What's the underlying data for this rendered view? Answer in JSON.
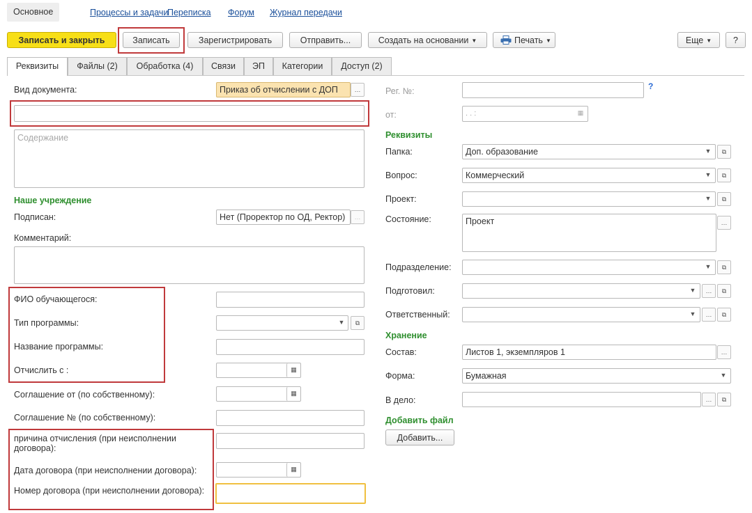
{
  "nav": {
    "active": "Основное",
    "items": [
      "Процессы и задачи",
      "Переписка",
      "Форум",
      "Журнал передачи"
    ]
  },
  "toolbar": {
    "save_close": "Записать и закрыть",
    "save": "Записать",
    "register": "Зарегистрировать",
    "send": "Отправить...",
    "create_based": "Создать на основании",
    "print": "Печать",
    "more": "Еще",
    "help": "?"
  },
  "tabs": [
    "Реквизиты",
    "Файлы (2)",
    "Обработка (4)",
    "Связи",
    "ЭП",
    "Категории",
    "Доступ (2)"
  ],
  "left": {
    "doc_type_label": "Вид документа:",
    "doc_type_value": "Приказ об отчислении с ДОП",
    "title_value": "",
    "content_placeholder": "Содержание",
    "our_org_header": "Наше учреждение",
    "signed_label": "Подписан:",
    "signed_value": "Нет (Проректор по ОД, Ректор)",
    "comment_label": "Комментарий:",
    "student_label": "ФИО обучающегося:",
    "program_type_label": "Тип программы:",
    "program_name_label": "Название программы:",
    "expel_from_label": "Отчислить с :",
    "agreement_from_label": "Соглашение от (по собственному):",
    "agreement_no_label": "Соглашение № (по собственному):",
    "reason_label": "причина отчисления (при неисполнении договора):",
    "contract_date_label": "Дата договора (при неисполнении договора):",
    "contract_no_label": "Номер договора (при неисполнении договора):"
  },
  "right": {
    "reg_no_label": "Рег. №:",
    "from_label": "от:",
    "date_placeholder": " .  .       :",
    "props_header": "Реквизиты",
    "folder_label": "Папка:",
    "folder_value": "Доп. образование",
    "question_label": "Вопрос:",
    "question_value": "Коммерческий",
    "project_label": "Проект:",
    "state_label": "Состояние:",
    "state_value": "Проект",
    "department_label": "Подразделение:",
    "prepared_label": "Подготовил:",
    "responsible_label": "Ответственный:",
    "storage_header": "Хранение",
    "composition_label": "Состав:",
    "composition_value": "Листов 1, экземпляров 1",
    "form_label": "Форма:",
    "form_value": "Бумажная",
    "to_file_label": "В дело:",
    "add_file_header": "Добавить файл",
    "add_button": "Добавить..."
  },
  "icons": {
    "dropdown": "chevron-down-icon",
    "open": "open-form-icon",
    "select": "ellipsis-icon",
    "calendar": "calendar-icon",
    "printer": "printer-icon"
  },
  "colors": {
    "primary_button": "#f7df18",
    "highlight_field": "#fbe3b0",
    "section_header": "#2f8f2f",
    "annotation_box": "#c0393b",
    "link": "#1a4f9a",
    "focus_border": "#f0c040"
  }
}
